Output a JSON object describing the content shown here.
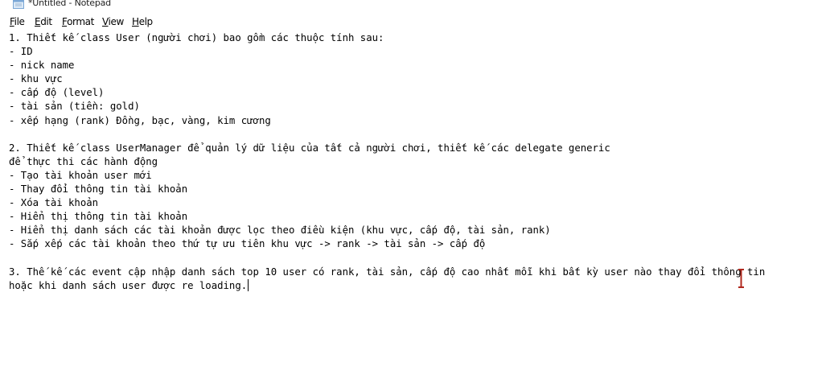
{
  "window": {
    "title": "*Untitled - Notepad"
  },
  "menu": {
    "items": [
      {
        "label": "File",
        "icon": "file-menu"
      },
      {
        "label": "Edit",
        "icon": "edit-menu"
      },
      {
        "label": "Format",
        "icon": "format-menu"
      },
      {
        "label": "View",
        "icon": "view-menu"
      },
      {
        "label": "Help",
        "icon": "help-menu"
      }
    ]
  },
  "editor": {
    "lines": [
      "1. Thiết kế class User (người chơi) bao gồm các thuộc tính sau:",
      "- ID",
      "- nick name",
      "- khu vực",
      "- cấp độ (level)",
      "- tài sản (tiền: gold)",
      "- xếp hạng (rank) Đồng, bạc, vàng, kim cương",
      "",
      "2. Thiết kế class UserManager để quản lý dữ liệu của tất cả người chơi, thiết kế các delegate generic",
      "để thực thi các hành động",
      "- Tạo tài khoản user mới",
      "- Thay đổi thông tin tài khoản",
      "- Xóa tài khoản",
      "- Hiển thị thông tin tài khoản",
      "- Hiển thị danh sách các tài khoản được lọc theo điều kiện (khu vực, cấp độ, tài sản, rank)",
      "- Sắp xếp các tài khoản theo thứ tự ưu tiên khu vực -> rank -> tài sản -> cấp độ",
      "",
      "3. Thế kế các event cập nhập danh sách top 10 user có rank, tài sản, cấp độ cao nhất mỗi khi bất kỳ user nào thay đổi thông tin",
      "hoặc khi danh sách user được re loading."
    ]
  },
  "colors": {
    "background": "#ffffff",
    "text": "#000000",
    "ibeam": "#b0281e"
  }
}
